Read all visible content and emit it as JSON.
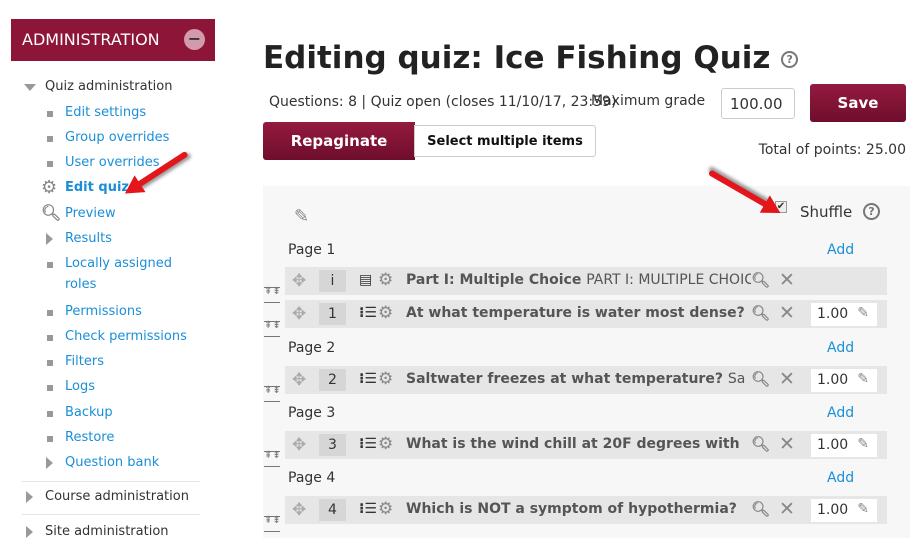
{
  "sidebar": {
    "header": "ADMINISTRATION",
    "quiz_admin": "Quiz administration",
    "items": [
      "Edit settings",
      "Group overrides",
      "User overrides",
      "Edit quiz",
      "Preview",
      "Results",
      "Locally assigned",
      "roles",
      "Permissions",
      "Check permissions",
      "Filters",
      "Logs",
      "Backup",
      "Restore",
      "Question bank"
    ],
    "course_admin": "Course administration",
    "site_admin": "Site administration"
  },
  "main": {
    "title": "Editing quiz: Ice Fishing Quiz",
    "info": "Questions: 8 | Quiz open (closes 11/10/17, 23:59)",
    "max_grade_label": "Maximum grade",
    "max_grade": "100.00",
    "save": "Save",
    "repaginate": "Repaginate",
    "select_multiple": "Select multiple items",
    "total_points": "Total of points: 25.00",
    "shuffle": "Shuffle",
    "shuffle_checked": true,
    "add": "Add",
    "pages": [
      "Page 1",
      "Page 2",
      "Page 3",
      "Page 4"
    ],
    "rows": [
      {
        "num": "i",
        "title": "Part I: Multiple Choice",
        "extra": "PART I: MULTIPLE CHOICE",
        "type_icon": "description-icon"
      },
      {
        "num": "1",
        "title": "At what temperature is water most dense?",
        "extra": "",
        "mark": "1.00",
        "type_icon": "multichoice-icon"
      },
      {
        "num": "2",
        "title": "Saltwater freezes at what temperature?",
        "extra": "Sa",
        "mark": "1.00",
        "type_icon": "multichoice-icon"
      },
      {
        "num": "3",
        "title": "What is the wind chill at 20F degrees with",
        "extra": "",
        "mark": "1.00",
        "type_icon": "multichoice-icon"
      },
      {
        "num": "4",
        "title": "Which is NOT a symptom of hypothermia?",
        "extra": "",
        "mark": "1.00",
        "type_icon": "multichoice-icon"
      }
    ]
  },
  "colors": {
    "brand": "#8d1538",
    "link": "#1a8fd8",
    "annotation_arrow": "#e3161b"
  }
}
